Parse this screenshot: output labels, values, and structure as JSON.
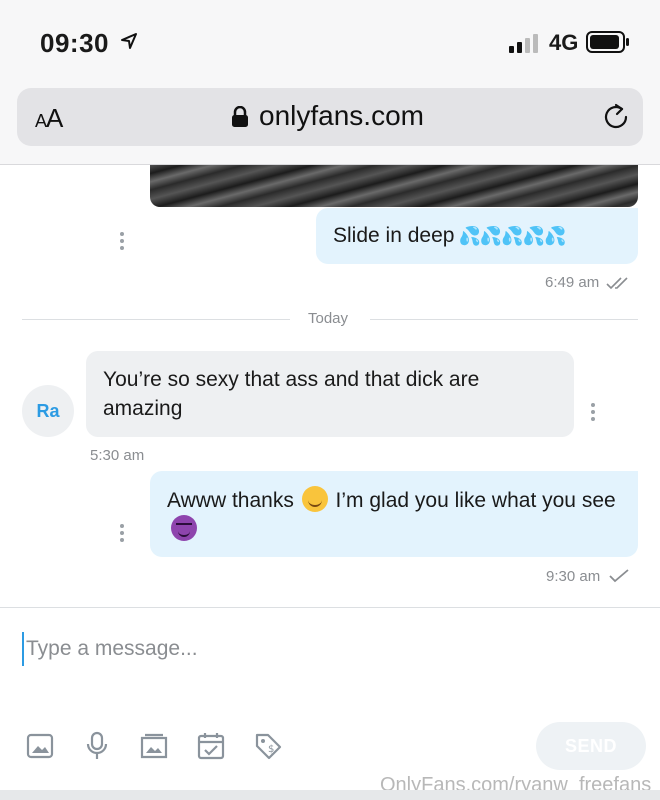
{
  "status_bar": {
    "time": "09:30",
    "network": "4G"
  },
  "browser": {
    "text_size_label_small": "A",
    "text_size_label_large": "A",
    "url": "onlyfans.com"
  },
  "chat": {
    "messages": [
      {
        "direction": "outgoing",
        "text": "Slide in deep",
        "emoji": "💦💦💦💦💦",
        "time": "6:49 am",
        "status": "read"
      },
      {
        "direction": "incoming",
        "sender_initials": "Ra",
        "text": "You’re so sexy that ass and that dick are amazing",
        "time": "5:30 am"
      },
      {
        "direction": "outgoing",
        "text_before": "Awww thanks",
        "text_after": "I’m glad you like what you see",
        "time": "9:30 am",
        "status": "sent"
      }
    ],
    "day_separator": "Today"
  },
  "composer": {
    "placeholder": "Type a message...",
    "send_label": "SEND"
  },
  "watermark": "OnlyFans.com/ryanw_freefans",
  "colors": {
    "accent": "#2c9be3",
    "outgoing_bubble": "#e3f3fd",
    "incoming_bubble": "#eef0f2"
  }
}
